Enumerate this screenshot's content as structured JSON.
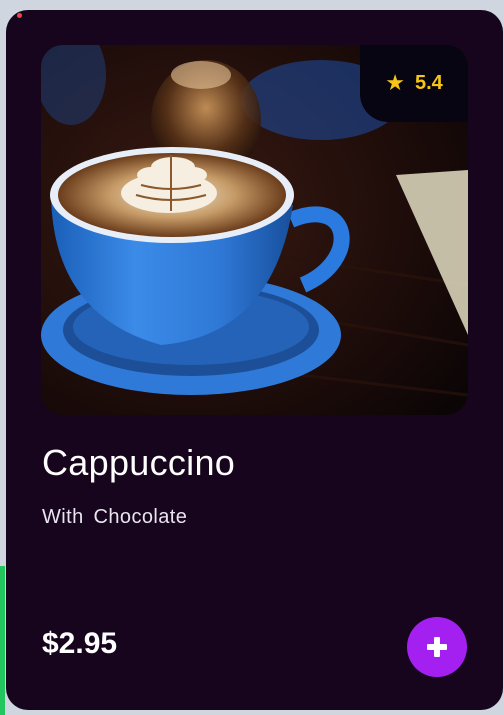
{
  "product": {
    "name": "Cappuccino",
    "subtitle": "With  Chocolate",
    "price": "$2.95",
    "rating": "5.4",
    "image_description": "cappuccino-photo"
  },
  "icons": {
    "rating": "star-icon",
    "add": "plus-icon"
  },
  "colors": {
    "card_background": "#16051d",
    "accent": "#a420f0",
    "rating": "#f5c518"
  }
}
